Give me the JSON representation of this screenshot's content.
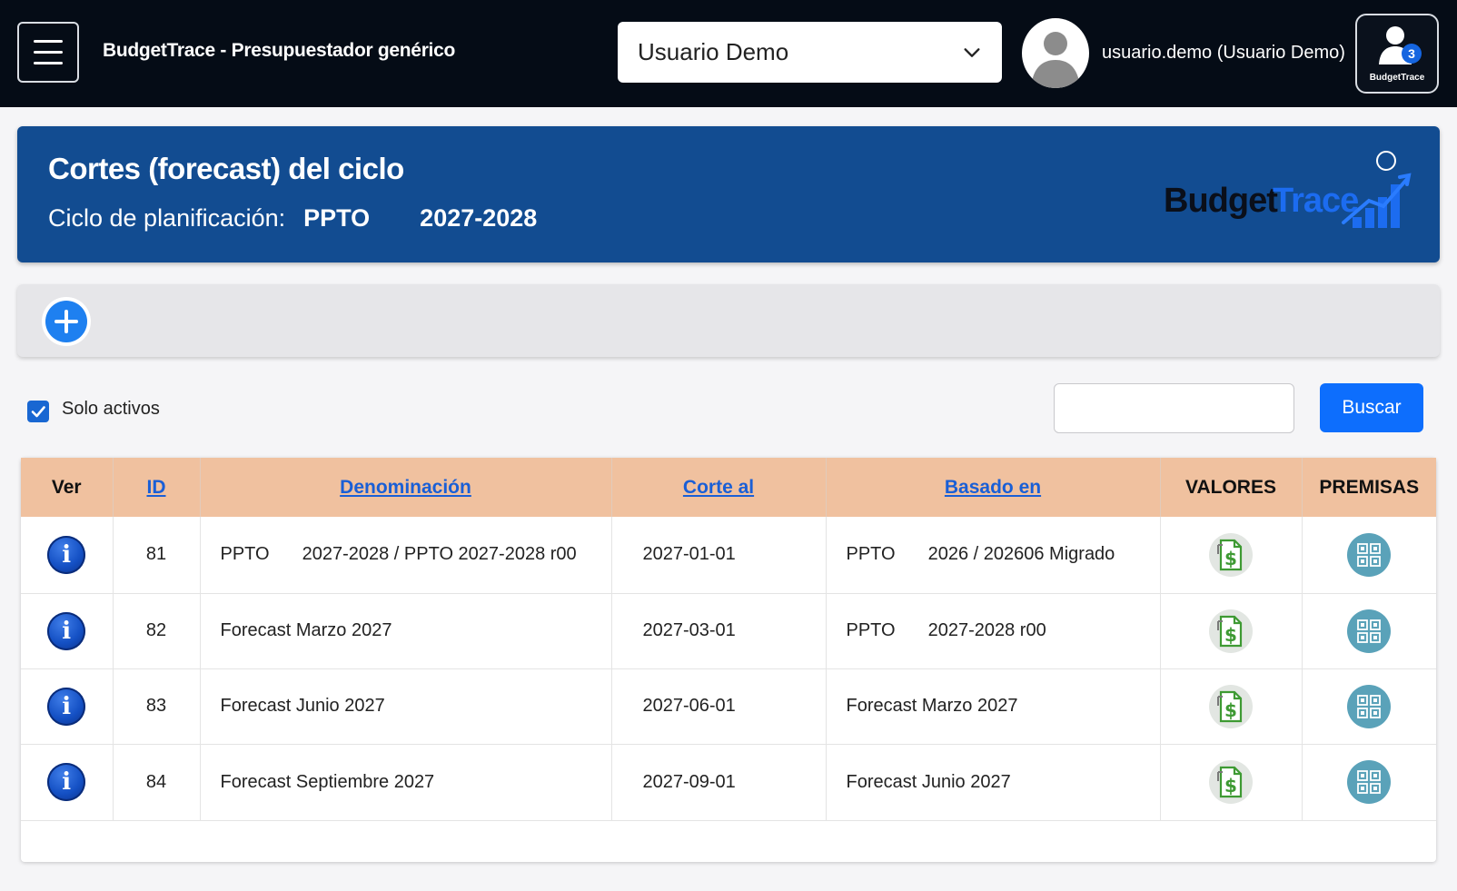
{
  "topbar": {
    "app_title": "BudgetTrace - Presupuestador genérico",
    "user_select": {
      "selected": "Usuario Demo"
    },
    "username": "usuario.demo (Usuario Demo)",
    "badge": {
      "count": "3",
      "label": "BudgetTrace"
    }
  },
  "header": {
    "title": "Cortes (forecast) del ciclo",
    "cycle_label": "Ciclo de planificación:",
    "cycle_code": "PPTO",
    "cycle_years": "2027-2028",
    "logo": {
      "text_dark": "Budget",
      "text_light": "Trace"
    }
  },
  "filters": {
    "only_active_label": "Solo activos",
    "only_active_checked": true,
    "search_value": "",
    "search_button": "Buscar"
  },
  "table": {
    "headers": {
      "ver": "Ver",
      "id": "ID",
      "denominacion": "Denominación",
      "corte_al": "Corte al",
      "basado_en": "Basado en",
      "valores": "VALORES",
      "premisas": "PREMISAS"
    },
    "rows": [
      {
        "id": "81",
        "den_a": "PPTO",
        "den_b": "2027-2028 / PPTO 2027-2028 r00",
        "corte": "2027-01-01",
        "base_a": "PPTO",
        "base_b": "2026 / 202606 Migrado"
      },
      {
        "id": "82",
        "den_a": "Forecast Marzo 2027",
        "den_b": "",
        "corte": "2027-03-01",
        "base_a": "PPTO",
        "base_b": "2027-2028 r00"
      },
      {
        "id": "83",
        "den_a": "Forecast Junio 2027",
        "den_b": "",
        "corte": "2027-06-01",
        "base_a": "Forecast Marzo 2027",
        "base_b": ""
      },
      {
        "id": "84",
        "den_a": "Forecast Septiembre 2027",
        "den_b": "",
        "corte": "2027-09-01",
        "base_a": "Forecast Junio 2027",
        "base_b": ""
      }
    ]
  },
  "icons": {
    "menu": "hamburger-menu-icon",
    "dropdown": "chevron-down-icon",
    "avatar": "user-avatar-icon",
    "add": "plus-icon",
    "info": "info-icon",
    "values": "dollar-document-icon",
    "premises": "grid-icon"
  },
  "colors": {
    "topbar_bg": "#050c16",
    "header_bg": "#124c91",
    "table_header_bg": "#f0c19f",
    "primary_button": "#0d6efd",
    "link": "#1a5fd6"
  }
}
